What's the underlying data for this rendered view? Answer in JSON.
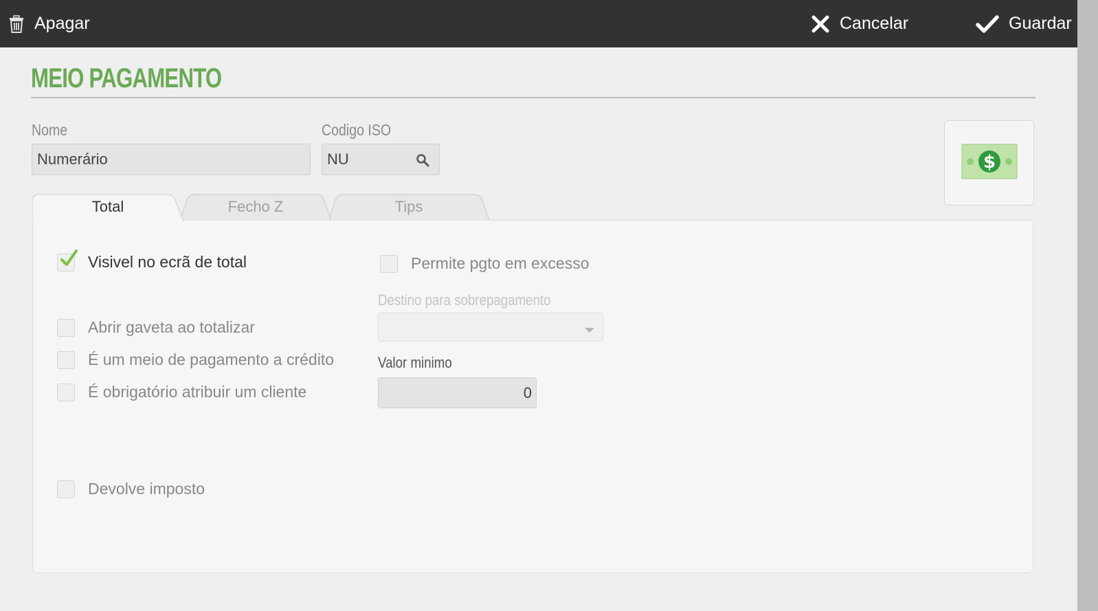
{
  "toolbar": {
    "delete_label": "Apagar",
    "cancel_label": "Cancelar",
    "save_label": "Guardar"
  },
  "page": {
    "title": "MEIO PAGAMENTO"
  },
  "form": {
    "nome_label": "Nome",
    "nome_value": "Numerário",
    "iso_label": "Codigo ISO",
    "iso_value": "NU"
  },
  "tabs": [
    {
      "label": "Total",
      "active": true
    },
    {
      "label": "Fecho Z",
      "active": false
    },
    {
      "label": "Tips",
      "active": false
    }
  ],
  "options": {
    "visivel_total": {
      "label": "Visivel no ecrã de total",
      "checked": true
    },
    "permite_excesso": {
      "label": "Permite pgto em excesso",
      "checked": false
    },
    "abrir_gaveta": {
      "label": "Abrir gaveta ao totalizar",
      "checked": false
    },
    "meio_credito": {
      "label": "É um meio de pagamento a crédito",
      "checked": false
    },
    "obrigatorio_cliente": {
      "label": "É obrigatório atribuir um cliente",
      "checked": false
    },
    "devolve_imposto": {
      "label": "Devolve imposto",
      "checked": false
    }
  },
  "overpayment": {
    "label": "Destino para sobrepagamento",
    "selected": ""
  },
  "minimum": {
    "label": "Valor minimo",
    "value": "0"
  },
  "colors": {
    "accent_green": "#6aaa55",
    "topbar": "#323232",
    "check_green": "#7cc242"
  },
  "icons": {
    "payment_icon": "dollar-bill-icon"
  }
}
